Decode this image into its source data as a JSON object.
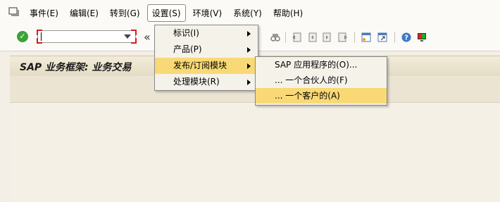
{
  "menubar": {
    "items": [
      {
        "label": "事件(E)"
      },
      {
        "label": "编辑(E)"
      },
      {
        "label": "转到(G)"
      },
      {
        "label": "设置(S)"
      },
      {
        "label": "环境(V)"
      },
      {
        "label": "系统(Y)"
      },
      {
        "label": "帮助(H)"
      }
    ]
  },
  "toolbar": {
    "command_value": "",
    "nav_glyph": "«"
  },
  "page": {
    "title": "SAP 业务框架: 业务交易"
  },
  "settings_menu": {
    "items": [
      {
        "label": "标识(I)"
      },
      {
        "label": "产品(P)"
      },
      {
        "label": "发布/订阅模块"
      },
      {
        "label": "处理模块(R)"
      }
    ]
  },
  "publish_submenu": {
    "items": [
      {
        "label": "SAP 应用程序的(O)..."
      },
      {
        "label": "... 一个合伙人的(F)"
      },
      {
        "label": "... 一个客户的(A)"
      }
    ]
  },
  "colors": {
    "highlight": "#f8d976",
    "title_band": "#e3dbc4",
    "check_green": "#3aa335"
  }
}
